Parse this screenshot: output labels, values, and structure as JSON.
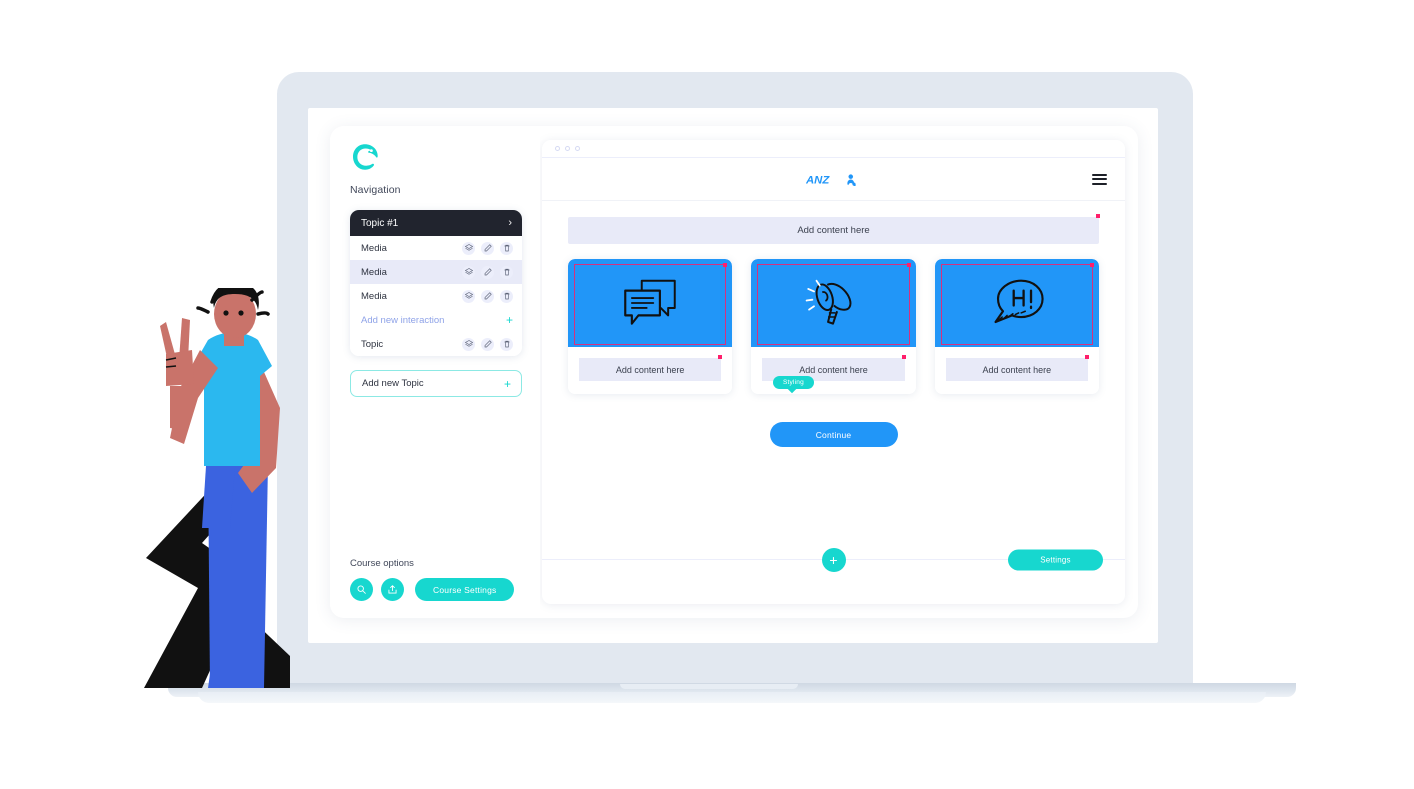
{
  "sidebar": {
    "logo_icon": "chameleon-logo-icon",
    "nav_label": "Navigation",
    "topic_header": {
      "title": "Topic #1",
      "chevron": "›"
    },
    "rows": [
      {
        "label": "Media",
        "actions": [
          "styling-icon",
          "edit-icon",
          "delete-icon"
        ],
        "selected": false
      },
      {
        "label": "Media",
        "actions": [
          "styling-icon",
          "edit-icon",
          "delete-icon"
        ],
        "selected": true
      },
      {
        "label": "Media",
        "actions": [
          "styling-icon",
          "edit-icon",
          "delete-icon"
        ],
        "selected": false
      }
    ],
    "add_interaction": {
      "label": "Add new interaction",
      "plus": "+"
    },
    "topic_row": {
      "label": "Topic",
      "actions": [
        "styling-icon",
        "edit-icon",
        "delete-icon"
      ]
    },
    "add_topic": {
      "label": "Add new Topic",
      "plus": "+"
    },
    "tooltip": "Styling",
    "course_options": {
      "title": "Course options",
      "search_icon": "search-icon",
      "publish_icon": "publish-icon",
      "settings_button": "Course Settings"
    }
  },
  "preview": {
    "browser_dots": 3,
    "site_logo": "ANZ",
    "menu_icon": "hamburger-menu-icon",
    "top_placeholder": "Add content here",
    "cards": [
      {
        "icon": "chat-bubbles-icon",
        "placeholder": "Add content here"
      },
      {
        "icon": "megaphone-icon",
        "placeholder": "Add content here"
      },
      {
        "icon": "speech-bubble-hi-icon",
        "placeholder": "Add content here"
      }
    ],
    "continue_button": "Continue",
    "add_block_button": "+",
    "settings_button": "Settings"
  },
  "colors": {
    "teal": "#17d7cf",
    "blue": "#2196f8",
    "dark": "#21242e",
    "placeholder_bg": "#e8eaf8",
    "selection_pink": "#d6317f",
    "handle_pink": "#ff1f6b",
    "laptop_bezel": "#e2e8f0"
  }
}
